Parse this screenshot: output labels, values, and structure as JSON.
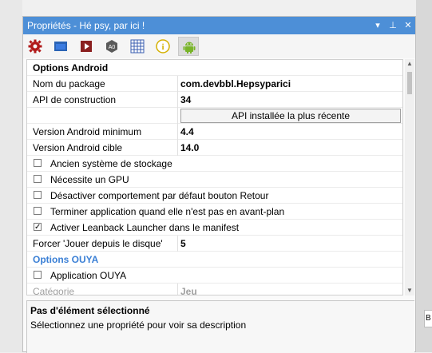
{
  "panel": {
    "title": "Propriétés - Hé psy, par ici !",
    "controls": {
      "dropdown": "▾",
      "pin": "⊥",
      "close": "✕"
    }
  },
  "toolbar": {
    "icons": [
      "gear-icon",
      "window-icon",
      "play-icon",
      "ao-icon",
      "grid-icon",
      "info-icon",
      "android-icon"
    ],
    "ao_text": "A0",
    "info_text": "i"
  },
  "sections": {
    "android": "Options Android",
    "ouya": "Options OUYA"
  },
  "properties": {
    "package_name": {
      "label": "Nom du package",
      "value": "com.devbbl.Hepsyparici"
    },
    "build_api": {
      "label": "API de construction",
      "value": "34"
    },
    "api_button": "API installée la plus récente",
    "min_version": {
      "label": "Version Android minimum",
      "value": "4.4"
    },
    "target_version": {
      "label": "Version Android cible",
      "value": "14.0"
    },
    "legacy_storage": {
      "label": "Ancien système de stockage",
      "checked": false
    },
    "requires_gpu": {
      "label": "Nécessite un GPU",
      "checked": false
    },
    "disable_back": {
      "label": "Désactiver comportement par défaut bouton Retour",
      "checked": false
    },
    "terminate_bg": {
      "label": "Terminer application quand elle n'est pas en avant-plan",
      "checked": false
    },
    "leanback": {
      "label": "Activer Leanback Launcher dans le manifest",
      "checked": true,
      "mark": "✓"
    },
    "play_from_disk": {
      "label": "Forcer 'Jouer depuis le disque'",
      "value": "5"
    },
    "ouya_app": {
      "label": "Application OUYA",
      "checked": false
    },
    "category": {
      "label": "Catégorie",
      "value": "Jeu"
    }
  },
  "description": {
    "title": "Pas d'élément sélectionné",
    "text": "Sélectionnez une propriété pour voir sa description"
  },
  "side_panel": {
    "label": "B"
  }
}
